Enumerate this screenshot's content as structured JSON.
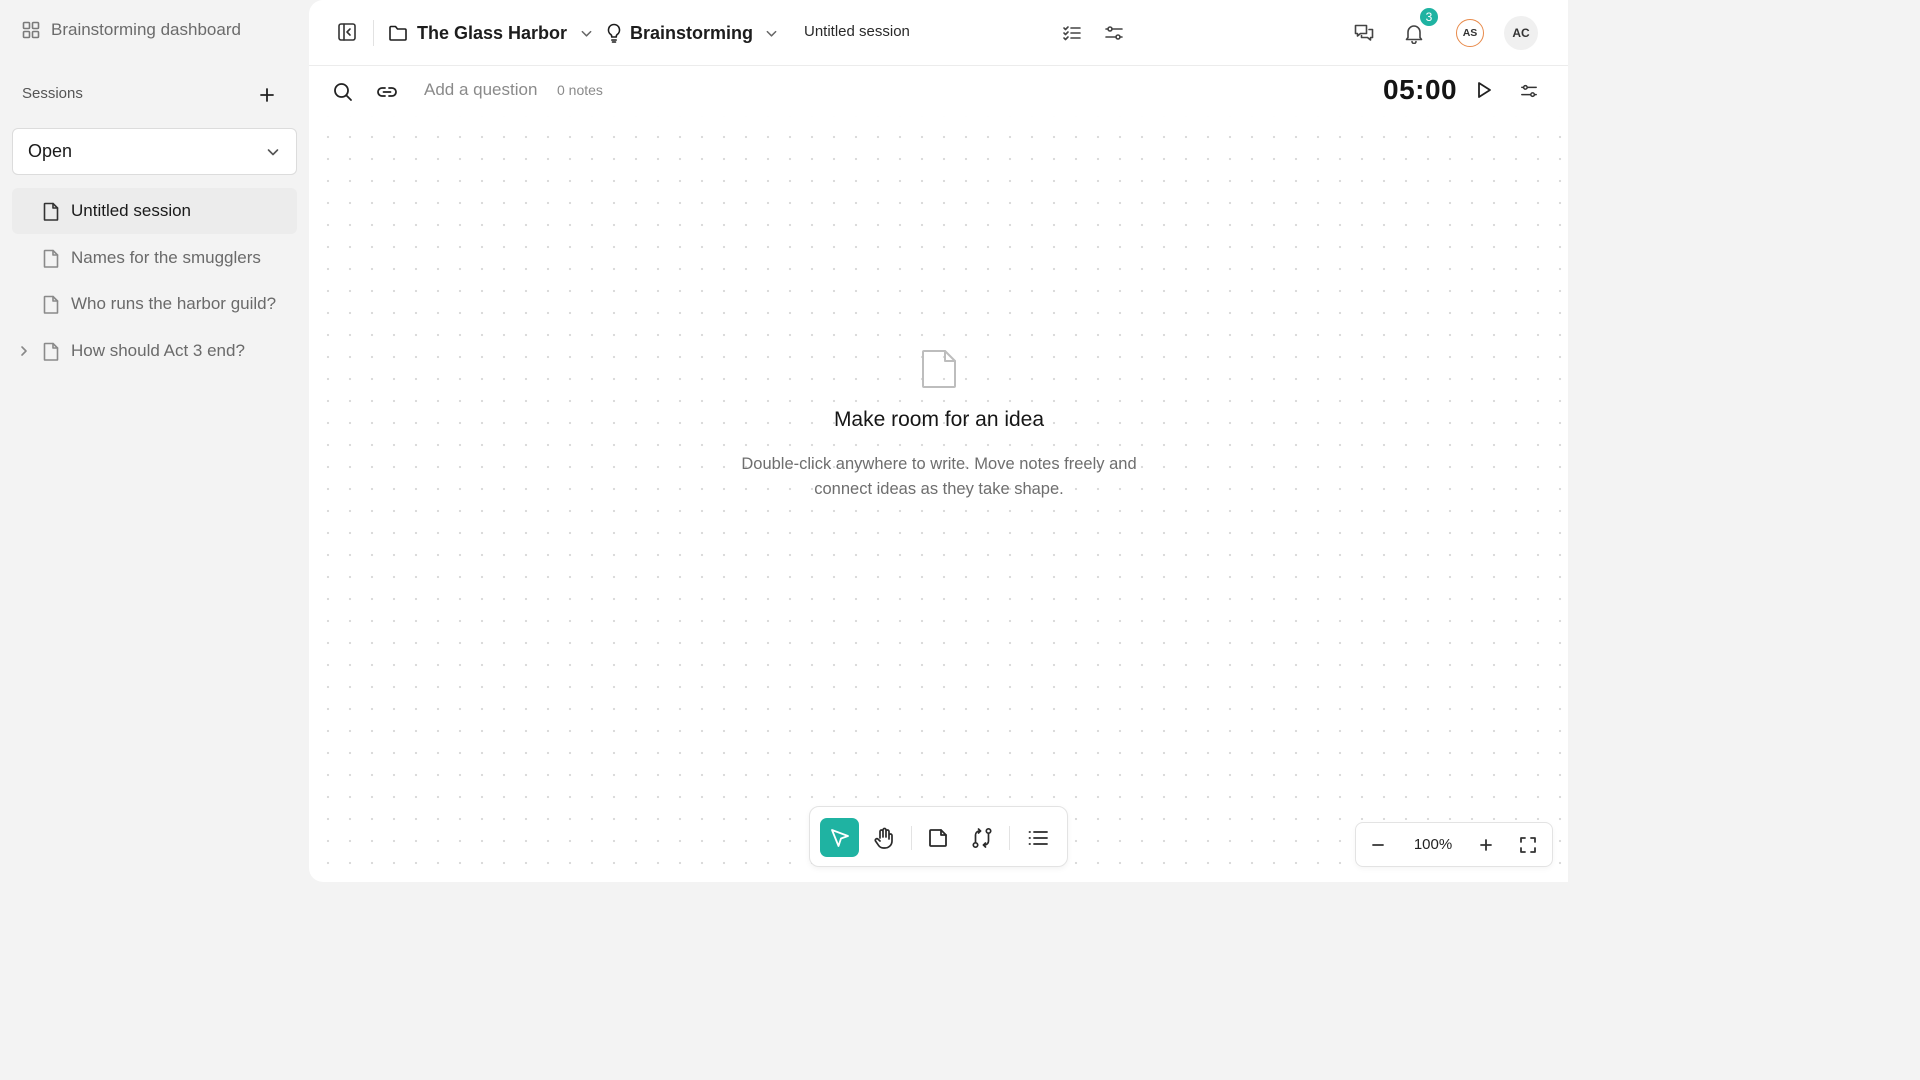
{
  "sidebar": {
    "dashboard_label": "Brainstorming dashboard",
    "sessions_label": "Sessions",
    "filter_value": "Open",
    "items": [
      {
        "label": "Untitled session",
        "active": true
      },
      {
        "label": "Names for the smugglers"
      },
      {
        "label": "Who runs the harbor guild?"
      },
      {
        "label": "How should Act 3 end?",
        "expandable": true
      }
    ]
  },
  "topbar": {
    "project": "The Glass Harbor",
    "mode": "Brainstorming",
    "session_title": "Untitled session",
    "notification_count": "3",
    "avatars": [
      "AS",
      "AC"
    ]
  },
  "subbar": {
    "question_placeholder": "Add a question",
    "notes_count": "0 notes",
    "timer": "05:00"
  },
  "empty_state": {
    "title": "Make room for an idea",
    "line1": "Double-click anywhere to write. Move notes freely and",
    "line2": "connect ideas as they take shape."
  },
  "zoom": {
    "level": "100%"
  },
  "colors": {
    "accent": "#1fb3a2",
    "avatar_ring": "#e88a4a"
  }
}
